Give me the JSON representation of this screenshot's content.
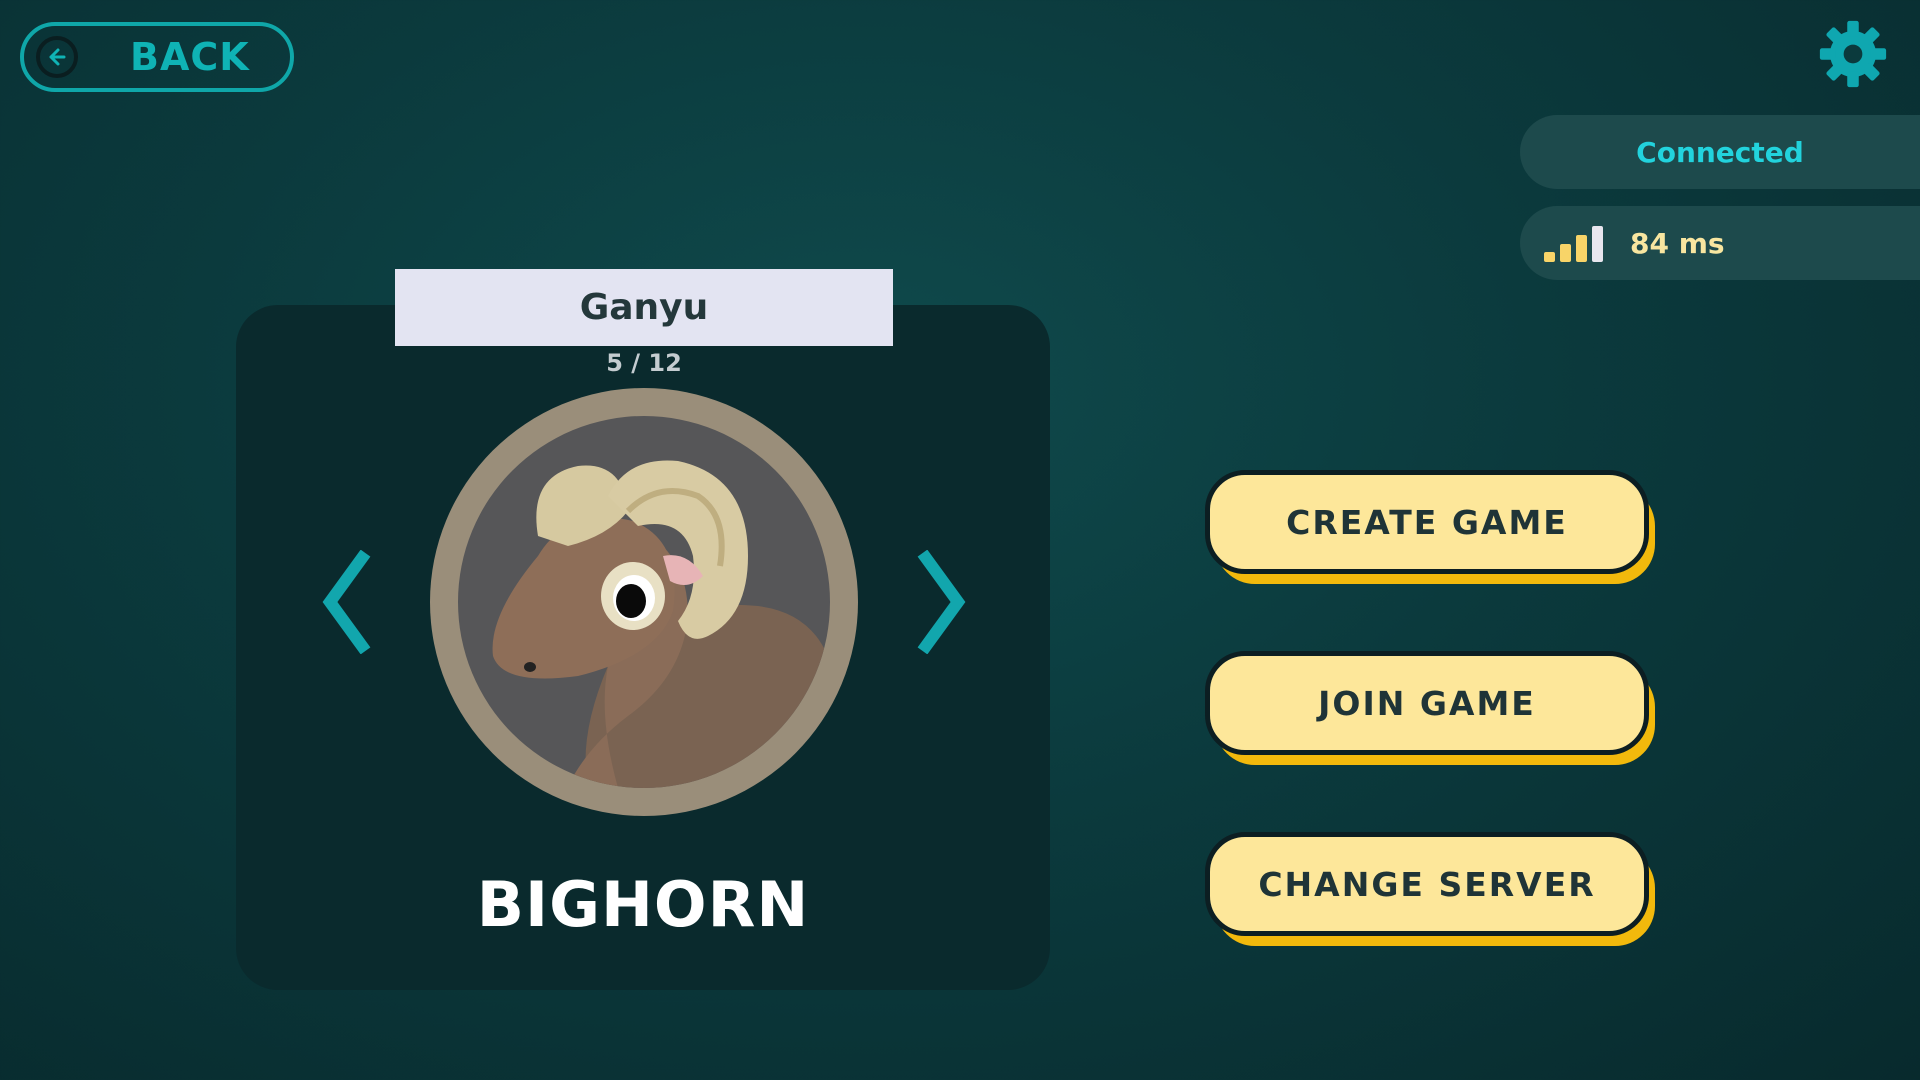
{
  "header": {
    "back_label": "BACK",
    "back_icon": "arrow-left-circle-icon",
    "settings_icon": "gear-icon"
  },
  "status": {
    "connection": "Connected",
    "ping": "84 ms",
    "signal_icon": "signal-bars-icon",
    "signal_bars_active": 4,
    "signal_bars_total": 4
  },
  "character": {
    "player_name": "Ganyu",
    "page": "5 / 12",
    "name": "BIGHORN",
    "portrait": "bighorn-ram-portrait"
  },
  "menu": {
    "create_label": "CREATE GAME",
    "join_label": "JOIN GAME",
    "server_label": "CHANGE SERVER"
  },
  "colors": {
    "accent_teal": "#0fb3b5",
    "button_face": "#fde79a",
    "button_shadow": "#f2b90c",
    "status_connected": "#22d3dd"
  }
}
